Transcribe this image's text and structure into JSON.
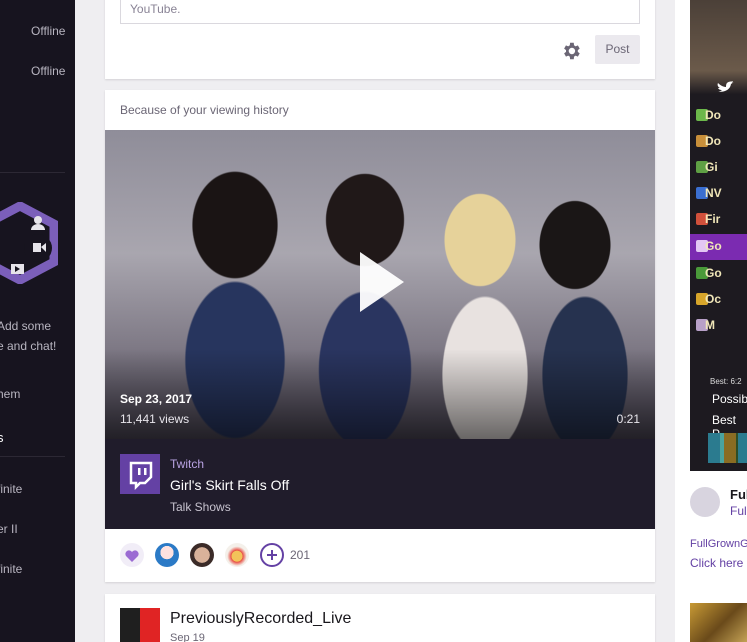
{
  "sidebar": {
    "status_1": "Offline",
    "status_2": "Offline",
    "prompt_line_1": "Add some",
    "prompt_line_2": "e and chat!",
    "prompt_link": "hem",
    "section_label": "s",
    "games": [
      "finite",
      "er II",
      "finite"
    ]
  },
  "composer": {
    "placeholder": "YouTube.",
    "post_label": "Post"
  },
  "recommendation": {
    "header": "Because of your viewing history",
    "video": {
      "date": "Sep 23, 2017",
      "views": "11,441 views",
      "duration": "0:21"
    },
    "channel": "Twitch",
    "title": "Girl's Skirt Falls Off",
    "category": "Talk Shows",
    "reaction_count": "201"
  },
  "next_post": {
    "channel": "PreviouslyRecorded_Live",
    "date": "Sep 19"
  },
  "right_panel": {
    "list_items": [
      "Do",
      "Do",
      "Gi",
      "NV",
      "Fir",
      "Go",
      "Go",
      "Oc",
      "M"
    ],
    "best_small": "Best: 6:2",
    "info_1": "Possib",
    "info_2": "Best P",
    "streamer_name": "Ful",
    "streamer_sub": "Full",
    "link_1": "FullGrownG",
    "link_2": "Click here"
  },
  "colors": {
    "brand_purple": "#6441a4",
    "heart": "#9b6bd3",
    "sidebar_bg": "#17141f",
    "meta_bg": "#201c2b"
  }
}
